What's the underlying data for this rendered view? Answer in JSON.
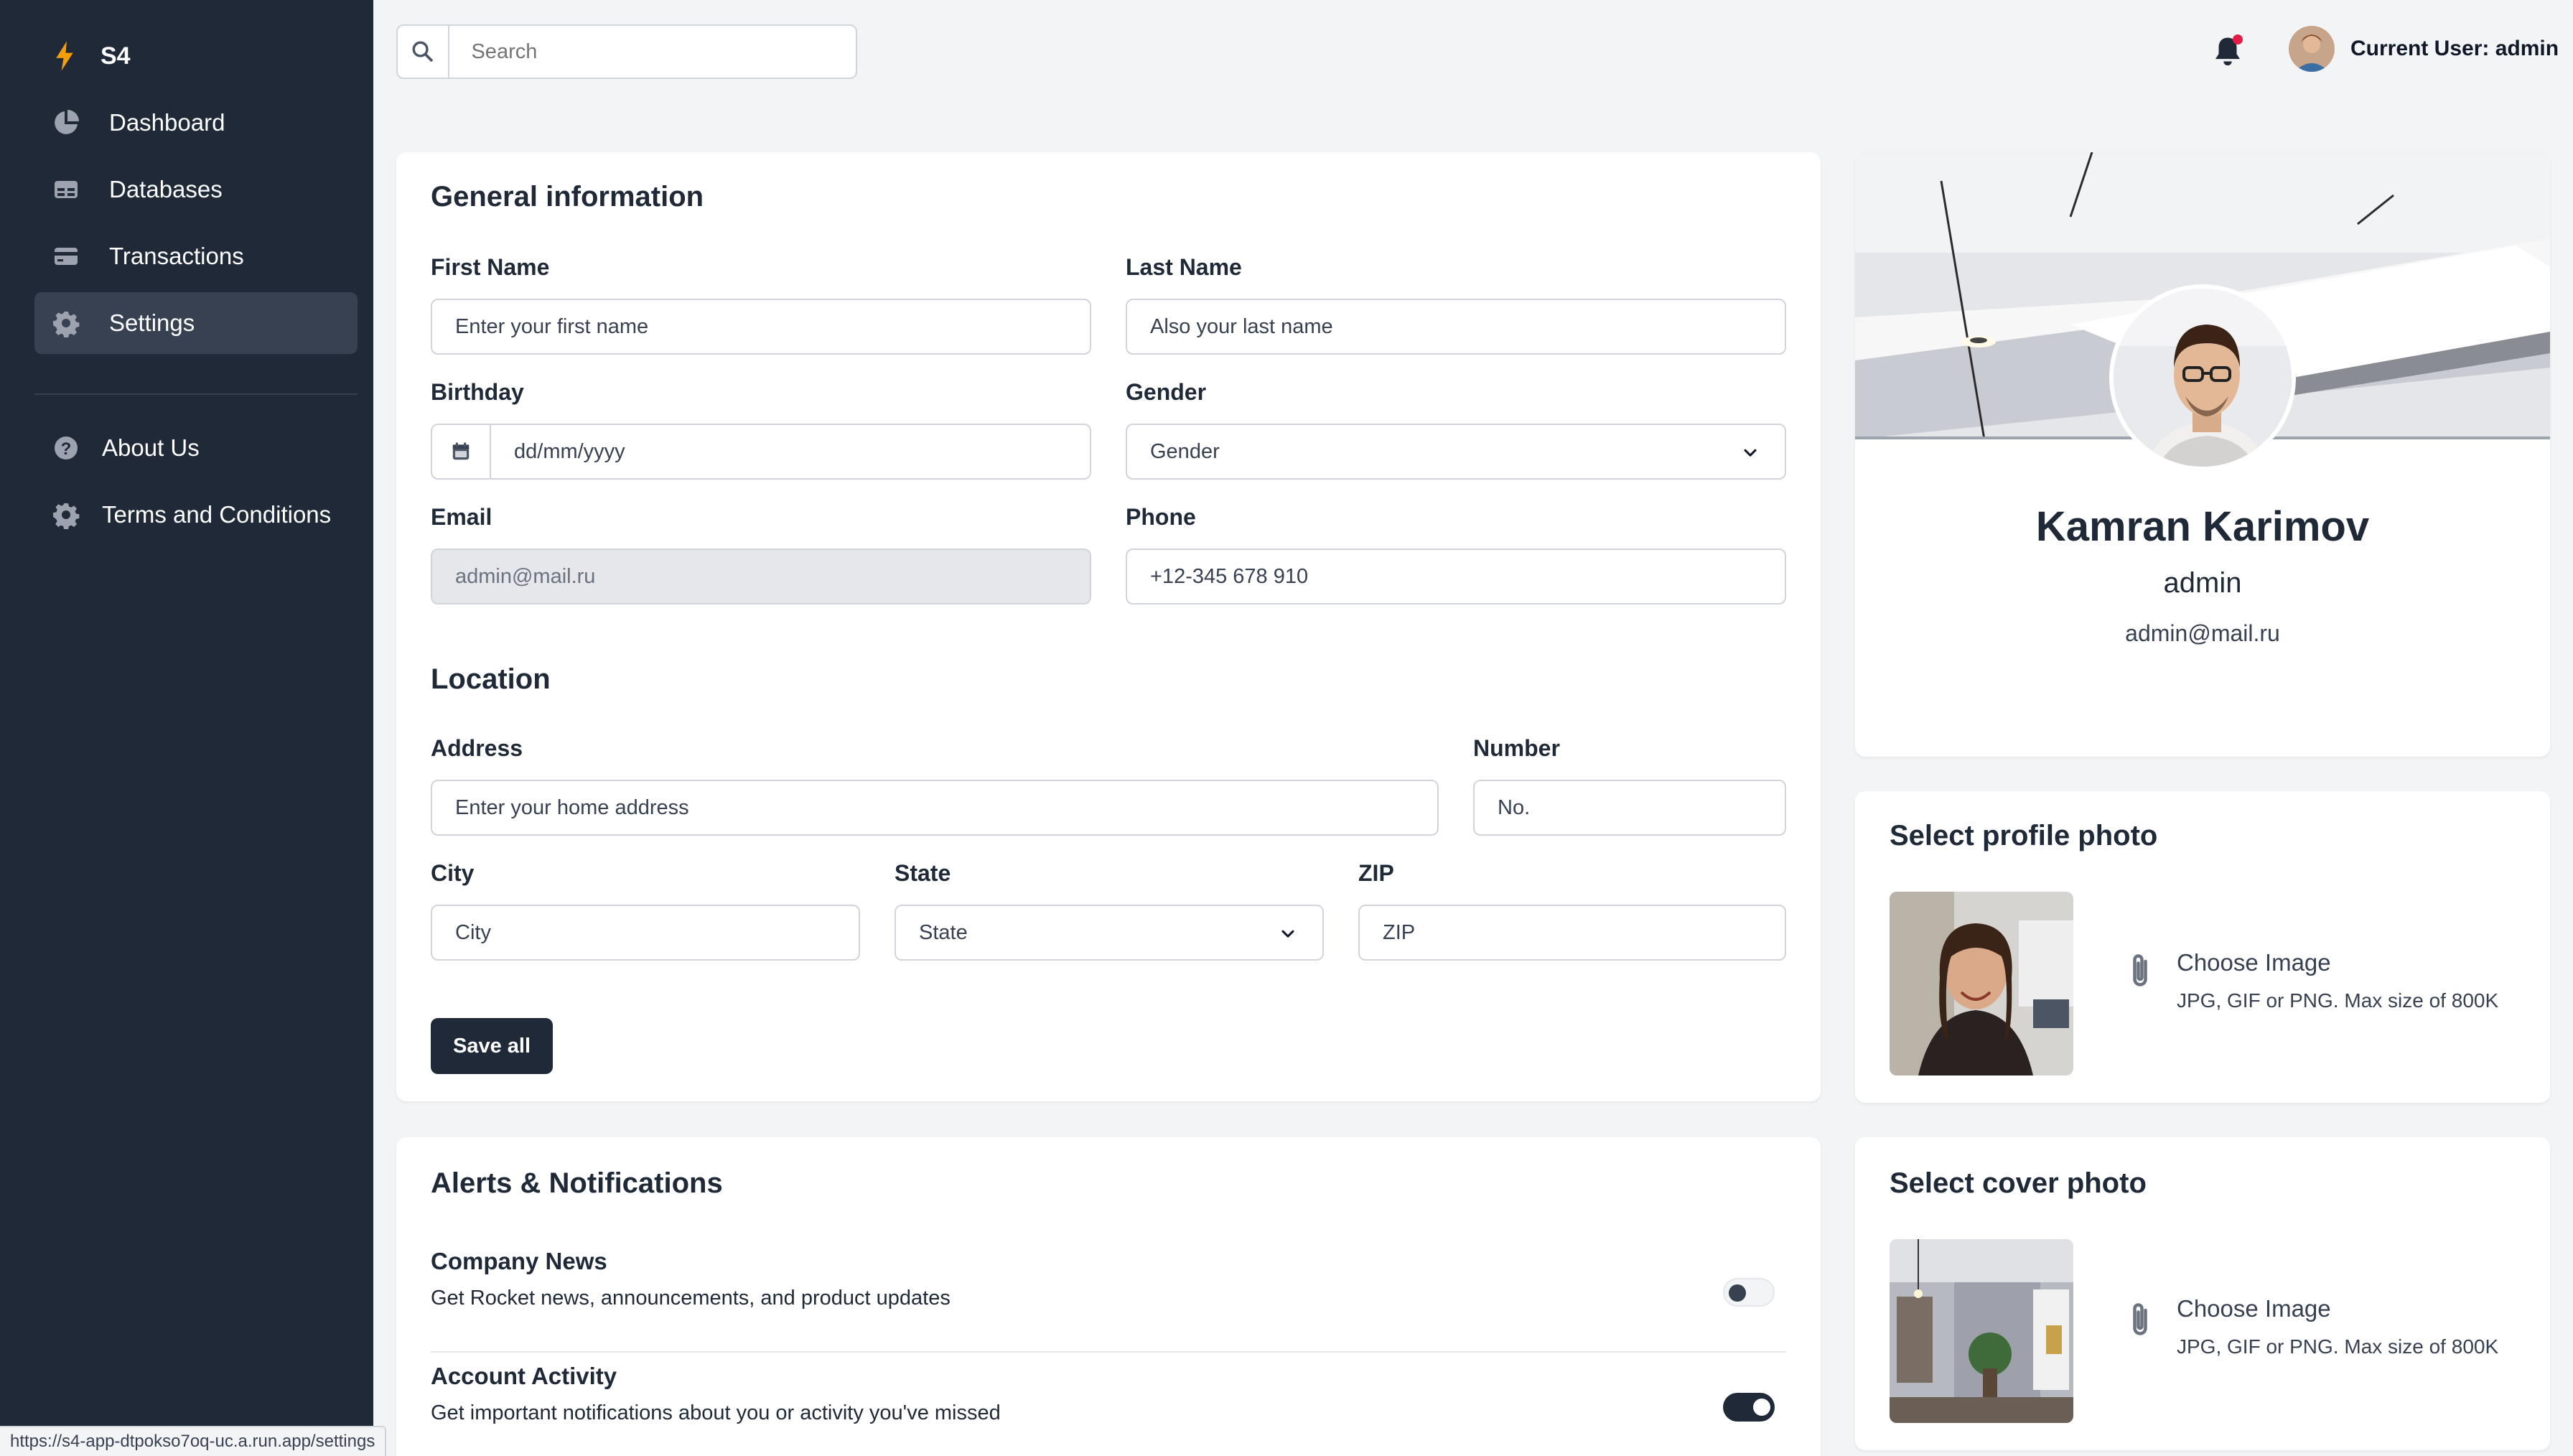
{
  "app": {
    "brand": "S4"
  },
  "sidebar": {
    "items": [
      {
        "label": "Dashboard",
        "icon": "pie-chart-icon"
      },
      {
        "label": "Databases",
        "icon": "table-icon"
      },
      {
        "label": "Transactions",
        "icon": "credit-card-icon"
      },
      {
        "label": "Settings",
        "icon": "gear-icon",
        "active": true
      }
    ],
    "secondary": [
      {
        "label": "About Us",
        "icon": "question-circle-icon"
      },
      {
        "label": "Terms and Conditions",
        "icon": "gear-icon"
      }
    ]
  },
  "topbar": {
    "search_placeholder": "Search",
    "user_label": "Current User: admin"
  },
  "general": {
    "title": "General information",
    "first_name": {
      "label": "First Name",
      "placeholder": "Enter your first name"
    },
    "last_name": {
      "label": "Last Name",
      "placeholder": "Also your last name"
    },
    "birthday": {
      "label": "Birthday",
      "placeholder": "dd/mm/yyyy"
    },
    "gender": {
      "label": "Gender",
      "value": "Gender"
    },
    "email": {
      "label": "Email",
      "value": "admin@mail.ru"
    },
    "phone": {
      "label": "Phone",
      "value": "+12-345 678 910"
    }
  },
  "location": {
    "title": "Location",
    "address": {
      "label": "Address",
      "placeholder": "Enter your home address"
    },
    "number": {
      "label": "Number",
      "placeholder": "No."
    },
    "city": {
      "label": "City",
      "placeholder": "City"
    },
    "state": {
      "label": "State",
      "value": "State"
    },
    "zip": {
      "label": "ZIP",
      "placeholder": "ZIP"
    },
    "save_label": "Save all"
  },
  "alerts": {
    "title": "Alerts & Notifications",
    "items": [
      {
        "title": "Company News",
        "desc": "Get Rocket news, announcements, and product updates",
        "enabled": false
      },
      {
        "title": "Account Activity",
        "desc": "Get important notifications about you or activity you've missed",
        "enabled": true
      }
    ]
  },
  "profile": {
    "name": "Kamran Karimov",
    "role": "admin",
    "email": "admin@mail.ru"
  },
  "profile_photo": {
    "title": "Select profile photo",
    "choose_label": "Choose Image",
    "hint": "JPG, GIF or PNG. Max size of 800K"
  },
  "cover_photo": {
    "title": "Select cover photo",
    "choose_label": "Choose Image",
    "hint": "JPG, GIF or PNG. Max size of 800K"
  },
  "statusbar": {
    "url": "https://s4-app-dtpokso7oq-uc.a.run.app/settings"
  }
}
